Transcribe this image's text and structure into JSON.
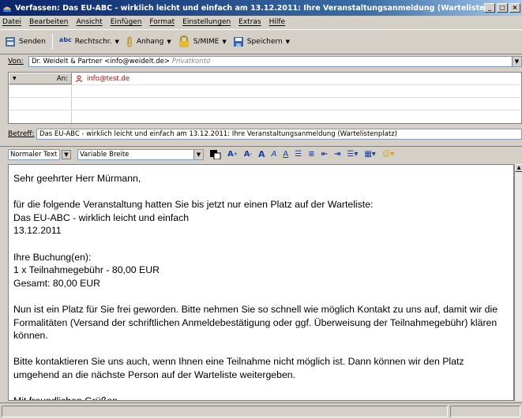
{
  "window": {
    "title": "Verfassen: Das EU-ABC - wirklich leicht und einfach am 13.12.2011: Ihre Veranstaltungsanmeldung (Wartelistenplatz)",
    "buttons": [
      "_",
      "□",
      "×"
    ]
  },
  "menu": [
    "Datei",
    "Bearbeiten",
    "Ansicht",
    "Einfügen",
    "Format",
    "Einstellungen",
    "Extras",
    "Hilfe"
  ],
  "toolbar": {
    "send": "Senden",
    "spell": "Rechtschr.",
    "attach": "Anhang",
    "smime": "S/MIME",
    "save": "Speichern",
    "spell_icon_text": "abc"
  },
  "from": {
    "label": "Von:",
    "value": "Dr. Weidelt & Partner <info@weidelt.de>",
    "account": "Privatkonto"
  },
  "recipients": [
    {
      "type": "An:",
      "address": "info@test.de"
    }
  ],
  "subject": {
    "label": "Betreff:",
    "value": "Das EU-ABC - wirklich leicht und einfach am 13.12.2011: Ihre Veranstaltungsanmeldung (Wartelistenplatz)"
  },
  "format": {
    "paragraph": "Normaler Text",
    "font": "Variable Breite"
  },
  "body": {
    "text": "Sehr geehrter Herr Mürmann,\n\nfür die folgende Veranstaltung hatten Sie bis jetzt nur einen Platz auf der Warteliste:\nDas EU-ABC - wirklich leicht und einfach\n13.12.2011\n\nIhre Buchung(en):\n1 x Teilnahmegebühr - 80,00 EUR\nGesamt: 80,00 EUR\n\nNun ist ein Platz für Sie frei geworden. Bitte nehmen Sie so schnell wie möglich Kontakt zu uns auf, damit wir die Formalitäten (Versand der schriftlichen Anmeldebestätigung oder ggf. Überweisung der Teilnahmegebühr) klären können.\n\nBitte kontaktieren Sie uns auch, wenn Ihnen eine Teilnahme nicht möglich ist. Dann können wir den Platz umgehend an die nächste Person auf der Warteliste weitergeben.\n\nMit freundlichen Grüßen"
  }
}
